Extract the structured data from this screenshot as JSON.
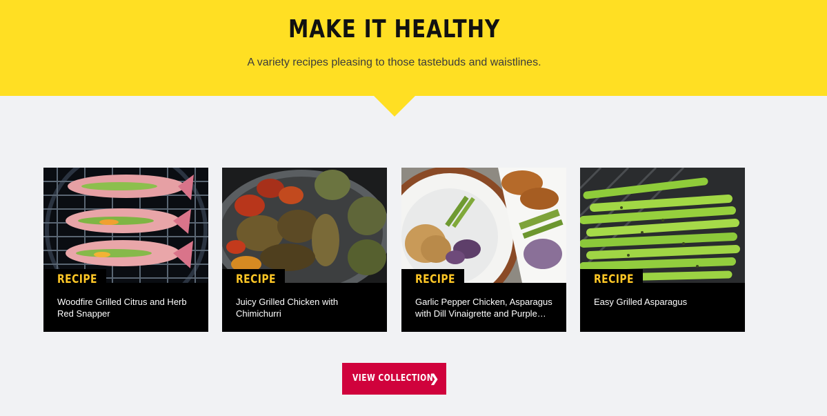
{
  "banner": {
    "title": "MAKE IT HEALTHY",
    "subtitle": "A variety recipes pleasing to those tastebuds and waistlines.",
    "color": "#ffdf23"
  },
  "cards": [
    {
      "tag": "RECIPE",
      "title": "Woodfire Grilled Citrus and Herb Red Snapper",
      "image": "grilled-snapper"
    },
    {
      "tag": "RECIPE",
      "title": "Juicy Grilled Chicken with Chimichurri",
      "image": "grilled-chicken"
    },
    {
      "tag": "RECIPE",
      "title": "Garlic Pepper Chicken, Asparagus with Dill Vinaigrette and Purple…",
      "image": "garlic-pepper-chicken"
    },
    {
      "tag": "RECIPE",
      "title": "Easy Grilled Asparagus",
      "image": "grilled-asparagus"
    }
  ],
  "cta": {
    "label": "VIEW COLLECTION",
    "icon": "chevron-right-icon",
    "color": "#d0023c"
  },
  "colors": {
    "page_bg": "#f1f2f4",
    "tag_text": "#ffc726",
    "card_bg": "#000000"
  }
}
